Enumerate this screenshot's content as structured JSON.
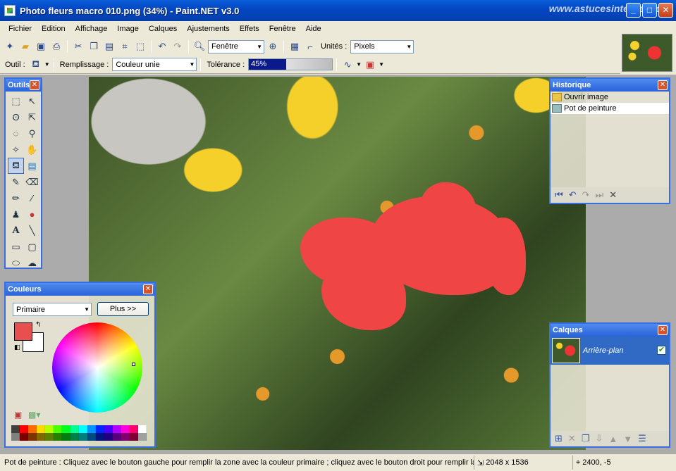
{
  "window": {
    "title": "Photo fleurs macro 010.png (34%) - Paint.NET v3.0",
    "watermark": "www.astucesinternet.com",
    "minimize": "_",
    "maximize": "□",
    "close": "✕"
  },
  "menu": [
    "Fichier",
    "Edition",
    "Affichage",
    "Image",
    "Calques",
    "Ajustements",
    "Effets",
    "Fenêtre",
    "Aide"
  ],
  "toolbar1": {
    "zoom_value": "Fenêtre",
    "units_label": "Unités :",
    "units_value": "Pixels"
  },
  "toolbar2": {
    "tool_label": "Outil :",
    "fill_label": "Remplissage :",
    "fill_value": "Couleur unie",
    "tolerance_label": "Tolérance :",
    "tolerance_value": "45%",
    "tolerance_fraction": 0.45
  },
  "tools_panel": {
    "title": "Outils"
  },
  "history_panel": {
    "title": "Historique",
    "items": [
      "Ouvrir image",
      "Pot de peinture"
    ]
  },
  "colors_panel": {
    "title": "Couleurs",
    "mode_value": "Primaire",
    "more_button": "Plus >>",
    "primary_color": "#e85050",
    "secondary_color": "#ffffff",
    "palette": [
      "#404040",
      "#ff0000",
      "#ff6a00",
      "#ffd800",
      "#b6ff00",
      "#4cff00",
      "#00ff21",
      "#00ff90",
      "#00ffff",
      "#0094ff",
      "#0026ff",
      "#4800ff",
      "#b200ff",
      "#ff00dc",
      "#ff006e",
      "#ffffff",
      "#808080",
      "#7f0000",
      "#7f3300",
      "#7f6a00",
      "#5b7f00",
      "#267f00",
      "#007f0e",
      "#007f46",
      "#007f7f",
      "#004a7f",
      "#00137f",
      "#21007f",
      "#57007f",
      "#7f006e",
      "#7f0037",
      "#a0a0a0"
    ]
  },
  "layers_panel": {
    "title": "Calques",
    "layer_name": "Arrière-plan",
    "visible_mark": "✔"
  },
  "status": {
    "message": "Pot de peinture : Cliquez avec le bouton gauche pour remplir la zone avec la couleur primaire ; cliquez avec le bouton droit pour remplir la z",
    "image_size": "2048 x 1536",
    "cursor_pos": "2400, -5"
  }
}
